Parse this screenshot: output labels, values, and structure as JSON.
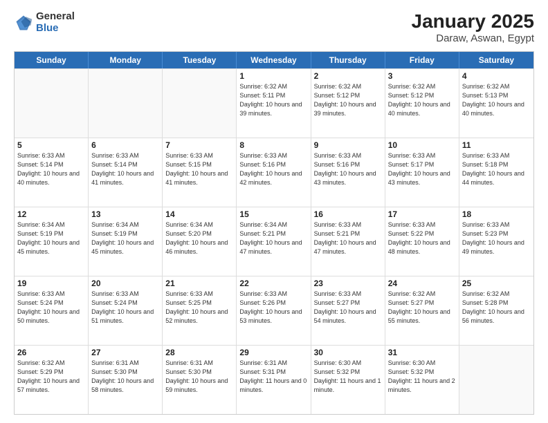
{
  "logo": {
    "general": "General",
    "blue": "Blue"
  },
  "title": "January 2025",
  "subtitle": "Daraw, Aswan, Egypt",
  "days": [
    "Sunday",
    "Monday",
    "Tuesday",
    "Wednesday",
    "Thursday",
    "Friday",
    "Saturday"
  ],
  "weeks": [
    [
      {
        "num": "",
        "info": "",
        "empty": true
      },
      {
        "num": "",
        "info": "",
        "empty": true
      },
      {
        "num": "",
        "info": "",
        "empty": true
      },
      {
        "num": "1",
        "info": "Sunrise: 6:32 AM\nSunset: 5:11 PM\nDaylight: 10 hours\nand 39 minutes."
      },
      {
        "num": "2",
        "info": "Sunrise: 6:32 AM\nSunset: 5:12 PM\nDaylight: 10 hours\nand 39 minutes."
      },
      {
        "num": "3",
        "info": "Sunrise: 6:32 AM\nSunset: 5:12 PM\nDaylight: 10 hours\nand 40 minutes."
      },
      {
        "num": "4",
        "info": "Sunrise: 6:32 AM\nSunset: 5:13 PM\nDaylight: 10 hours\nand 40 minutes."
      }
    ],
    [
      {
        "num": "5",
        "info": "Sunrise: 6:33 AM\nSunset: 5:14 PM\nDaylight: 10 hours\nand 40 minutes."
      },
      {
        "num": "6",
        "info": "Sunrise: 6:33 AM\nSunset: 5:14 PM\nDaylight: 10 hours\nand 41 minutes."
      },
      {
        "num": "7",
        "info": "Sunrise: 6:33 AM\nSunset: 5:15 PM\nDaylight: 10 hours\nand 41 minutes."
      },
      {
        "num": "8",
        "info": "Sunrise: 6:33 AM\nSunset: 5:16 PM\nDaylight: 10 hours\nand 42 minutes."
      },
      {
        "num": "9",
        "info": "Sunrise: 6:33 AM\nSunset: 5:16 PM\nDaylight: 10 hours\nand 43 minutes."
      },
      {
        "num": "10",
        "info": "Sunrise: 6:33 AM\nSunset: 5:17 PM\nDaylight: 10 hours\nand 43 minutes."
      },
      {
        "num": "11",
        "info": "Sunrise: 6:33 AM\nSunset: 5:18 PM\nDaylight: 10 hours\nand 44 minutes."
      }
    ],
    [
      {
        "num": "12",
        "info": "Sunrise: 6:34 AM\nSunset: 5:19 PM\nDaylight: 10 hours\nand 45 minutes."
      },
      {
        "num": "13",
        "info": "Sunrise: 6:34 AM\nSunset: 5:19 PM\nDaylight: 10 hours\nand 45 minutes."
      },
      {
        "num": "14",
        "info": "Sunrise: 6:34 AM\nSunset: 5:20 PM\nDaylight: 10 hours\nand 46 minutes."
      },
      {
        "num": "15",
        "info": "Sunrise: 6:34 AM\nSunset: 5:21 PM\nDaylight: 10 hours\nand 47 minutes."
      },
      {
        "num": "16",
        "info": "Sunrise: 6:33 AM\nSunset: 5:21 PM\nDaylight: 10 hours\nand 47 minutes."
      },
      {
        "num": "17",
        "info": "Sunrise: 6:33 AM\nSunset: 5:22 PM\nDaylight: 10 hours\nand 48 minutes."
      },
      {
        "num": "18",
        "info": "Sunrise: 6:33 AM\nSunset: 5:23 PM\nDaylight: 10 hours\nand 49 minutes."
      }
    ],
    [
      {
        "num": "19",
        "info": "Sunrise: 6:33 AM\nSunset: 5:24 PM\nDaylight: 10 hours\nand 50 minutes."
      },
      {
        "num": "20",
        "info": "Sunrise: 6:33 AM\nSunset: 5:24 PM\nDaylight: 10 hours\nand 51 minutes."
      },
      {
        "num": "21",
        "info": "Sunrise: 6:33 AM\nSunset: 5:25 PM\nDaylight: 10 hours\nand 52 minutes."
      },
      {
        "num": "22",
        "info": "Sunrise: 6:33 AM\nSunset: 5:26 PM\nDaylight: 10 hours\nand 53 minutes."
      },
      {
        "num": "23",
        "info": "Sunrise: 6:33 AM\nSunset: 5:27 PM\nDaylight: 10 hours\nand 54 minutes."
      },
      {
        "num": "24",
        "info": "Sunrise: 6:32 AM\nSunset: 5:27 PM\nDaylight: 10 hours\nand 55 minutes."
      },
      {
        "num": "25",
        "info": "Sunrise: 6:32 AM\nSunset: 5:28 PM\nDaylight: 10 hours\nand 56 minutes."
      }
    ],
    [
      {
        "num": "26",
        "info": "Sunrise: 6:32 AM\nSunset: 5:29 PM\nDaylight: 10 hours\nand 57 minutes."
      },
      {
        "num": "27",
        "info": "Sunrise: 6:31 AM\nSunset: 5:30 PM\nDaylight: 10 hours\nand 58 minutes."
      },
      {
        "num": "28",
        "info": "Sunrise: 6:31 AM\nSunset: 5:30 PM\nDaylight: 10 hours\nand 59 minutes."
      },
      {
        "num": "29",
        "info": "Sunrise: 6:31 AM\nSunset: 5:31 PM\nDaylight: 11 hours\nand 0 minutes."
      },
      {
        "num": "30",
        "info": "Sunrise: 6:30 AM\nSunset: 5:32 PM\nDaylight: 11 hours\nand 1 minute."
      },
      {
        "num": "31",
        "info": "Sunrise: 6:30 AM\nSunset: 5:32 PM\nDaylight: 11 hours\nand 2 minutes."
      },
      {
        "num": "",
        "info": "",
        "empty": true
      }
    ]
  ]
}
